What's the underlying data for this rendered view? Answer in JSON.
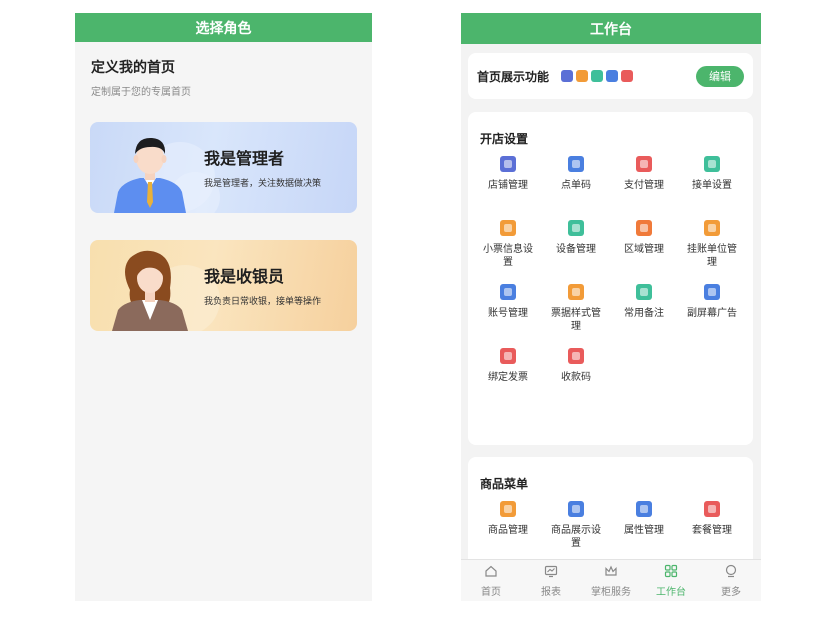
{
  "left": {
    "header": {
      "title": "选择角色"
    },
    "intro": {
      "title": "定义我的首页",
      "subtitle": "定制属于您的专属首页"
    },
    "roles": [
      {
        "title": "我是管理者",
        "desc": "我是管理者，关注数据做决策"
      },
      {
        "title": "我是收银员",
        "desc": "我负责日常收银，接单等操作"
      }
    ]
  },
  "right": {
    "header": {
      "title": "工作台"
    },
    "home": {
      "label": "首页展示功能",
      "edit_label": "编辑"
    },
    "store_section": {
      "title": "开店设置",
      "items": [
        {
          "label": "店铺管理",
          "icon": "store-icon",
          "color": "#5b6fd6"
        },
        {
          "label": "点单码",
          "icon": "qr-grid-icon",
          "color": "#4a7fe0"
        },
        {
          "label": "支付管理",
          "icon": "wallet-icon",
          "color": "#e95b5b"
        },
        {
          "label": "接单设置",
          "icon": "order-inbox-icon",
          "color": "#3fbf9a"
        },
        {
          "label": "小票信息设置",
          "icon": "receipt-icon",
          "color": "#f29b38"
        },
        {
          "label": "设备管理",
          "icon": "device-icon",
          "color": "#3fbf9a"
        },
        {
          "label": "区域管理",
          "icon": "area-icon",
          "color": "#f07a3a"
        },
        {
          "label": "挂账单位管理",
          "icon": "ledger-icon",
          "color": "#f29b38"
        },
        {
          "label": "账号管理",
          "icon": "account-icon",
          "color": "#4a7fe0"
        },
        {
          "label": "票据样式管理",
          "icon": "ticket-style-icon",
          "color": "#f29b38"
        },
        {
          "label": "常用备注",
          "icon": "note-icon",
          "color": "#3fbf9a"
        },
        {
          "label": "副屏幕广告",
          "icon": "image-ad-icon",
          "color": "#4a7fe0"
        },
        {
          "label": "绑定发票",
          "icon": "invoice-icon",
          "color": "#e95b5b"
        },
        {
          "label": "收款码",
          "icon": "pay-code-icon",
          "color": "#e95b5b"
        }
      ]
    },
    "goods_section": {
      "title": "商品菜单",
      "items": [
        {
          "label": "商品管理",
          "icon": "goods-icon",
          "color": "#f29b38"
        },
        {
          "label": "商品展示设置",
          "icon": "display-icon",
          "color": "#4a7fe0"
        },
        {
          "label": "属性管理",
          "icon": "attribute-icon",
          "color": "#4a7fe0"
        },
        {
          "label": "套餐管理",
          "icon": "combo-icon",
          "color": "#e95b5b"
        }
      ]
    },
    "home_mini_icons": [
      {
        "icon": "mini-store-icon",
        "color": "#5b6fd6"
      },
      {
        "icon": "mini-receipt-icon",
        "color": "#f29b38"
      },
      {
        "icon": "mini-device-icon",
        "color": "#3fbf9a"
      },
      {
        "icon": "mini-qr-icon",
        "color": "#4a7fe0"
      },
      {
        "icon": "mini-wallet-icon",
        "color": "#e95b5b"
      }
    ],
    "tabs": [
      {
        "label": "首页",
        "icon": "home-icon",
        "active": false
      },
      {
        "label": "报表",
        "icon": "report-icon",
        "active": false
      },
      {
        "label": "掌柜服务",
        "icon": "crown-icon",
        "active": false
      },
      {
        "label": "工作台",
        "icon": "workbench-icon",
        "active": true
      },
      {
        "label": "更多",
        "icon": "more-icon",
        "active": false
      }
    ]
  },
  "theme": {
    "accent": "#4cb56c"
  }
}
